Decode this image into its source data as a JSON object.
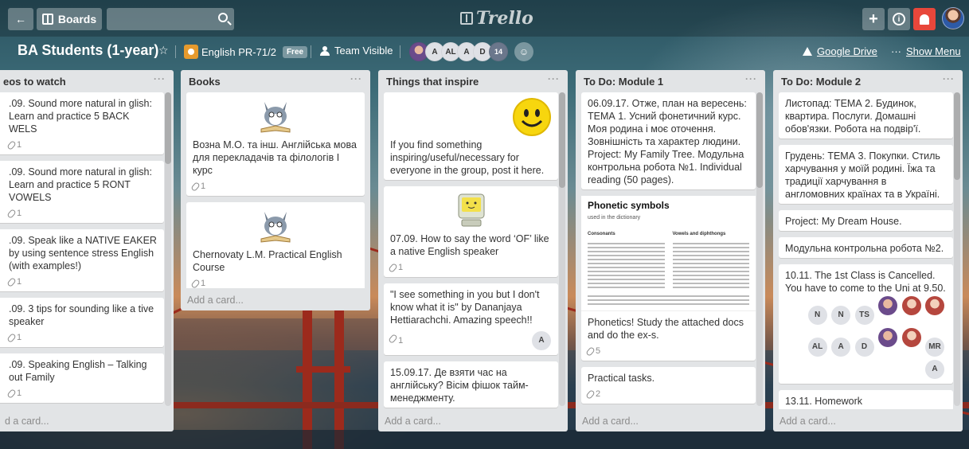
{
  "header": {
    "boards_label": "Boards",
    "logo_text": "Trello",
    "add_symbol": "+",
    "info_symbol": "i"
  },
  "board": {
    "title": "BA Students (1-year)",
    "org_name": "English PR-71/2",
    "org_badge": "Free",
    "visibility": "Team Visible",
    "members": [
      "A",
      "AL",
      "A",
      "D"
    ],
    "member_count": "14",
    "google_drive": "Google Drive",
    "show_menu": "Show Menu",
    "menu_dots": "···"
  },
  "lists": [
    {
      "title": "eos to watch",
      "menu": "···",
      "add_card": "d a card...",
      "cards": [
        {
          "text": ".09. Sound more natural in glish: Learn and practice 5 BACK WELS",
          "attachments": "1"
        },
        {
          "text": ".09. Sound more natural in glish: Learn and practice 5 RONT VOWELS",
          "attachments": "1"
        },
        {
          "text": ".09. Speak like a NATIVE EAKER by using sentence stress English (with examples!)",
          "attachments": "1"
        },
        {
          "text": ".09. 3 tips for sounding like a tive speaker",
          "attachments": "1"
        },
        {
          "text": ".09. Speaking English – Talking out Family",
          "attachments": "1"
        }
      ]
    },
    {
      "title": "Books",
      "menu": "···",
      "add_card": "Add a card...",
      "cards": [
        {
          "text": "Вознa М.О. та інш. Англійська мова для перекладачів та філологів I курс",
          "attachments": "1"
        },
        {
          "text": "Chernovaty L.M. Practical English Course",
          "attachments": "1"
        }
      ]
    },
    {
      "title": "Things that inspire",
      "menu": "···",
      "add_card": "Add a card...",
      "cards": [
        {
          "text": "If you find something inspiring/useful/necessary for everyone in the group, post it here."
        },
        {
          "text": "07.09. How to say the word ‘OF’ like a native English speaker",
          "attachments": "1"
        },
        {
          "text": "\"I see something in you but I don't know what it is\" by Dananjaya Hettiarachchi. Amazing speech!!",
          "attachments": "1",
          "member": "A"
        },
        {
          "text": "15.09.17. Де взяти час на англійську? Вісім фішок тайм-менеджменту."
        }
      ]
    },
    {
      "title": "To Do: Module 1",
      "menu": "···",
      "add_card": "Add a card...",
      "cards": [
        {
          "text": "06.09.17. Отже, план на вересень: ТЕМА 1. Усний фонетичний курс. Моя родина і моє оточення. Зовнішність та характер людини. Project: My Family Tree. Модульна контрольна робота №1. Individual reading (50 pages)."
        },
        {
          "text": "Phonetics! Study the attached docs and do the ex-s.",
          "attachments": "5",
          "doc_title": "Phonetic symbols",
          "doc_sub": "used in the dictionary",
          "doc_col1": "Consonants",
          "doc_col2": "Vowels and diphthongs"
        },
        {
          "text": "Practical tasks.",
          "attachments": "2"
        }
      ]
    },
    {
      "title": "To Do: Module 2",
      "menu": "···",
      "add_card": "Add a card...",
      "cards": [
        {
          "text": "Листопад: ТЕМА 2. Будинок, квартира. Послуги. Домашні обов'язки. Робота на подвір'ї."
        },
        {
          "text": "Грудень: ТЕМА 3. Покупки. Стиль харчування у моїй родині. Їжа та традиції харчування в англомовних країнах та в Україні."
        },
        {
          "text": "Project: My Dream House."
        },
        {
          "text": "Модульна контрольна робота №2."
        },
        {
          "text": "10.11. The 1st Class is Cancelled. You have to come to the Uni at 9.50.",
          "members_row1": [
            "N",
            "N",
            "TS"
          ],
          "members_row2": [
            "AL",
            "A",
            "D",
            "MR"
          ],
          "members_row3": [
            "A"
          ]
        },
        {
          "text": "13.11. Homework"
        }
      ]
    }
  ]
}
